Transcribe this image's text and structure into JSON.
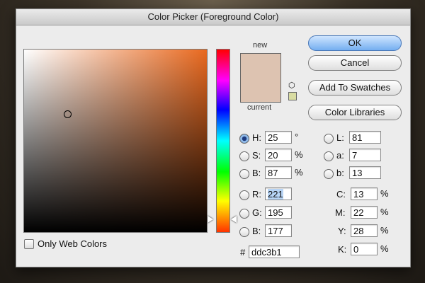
{
  "window": {
    "title": "Color Picker (Foreground Color)"
  },
  "preview": {
    "new_label": "new",
    "current_label": "current",
    "new_color": "#ddc3b1",
    "current_color": "#ddc3b1"
  },
  "buttons": {
    "ok": "OK",
    "cancel": "Cancel",
    "add_to_swatches": "Add To Swatches",
    "color_libraries": "Color Libraries"
  },
  "hsb": {
    "h_label": "H:",
    "h_value": "25",
    "h_unit": "°",
    "s_label": "S:",
    "s_value": "20",
    "s_unit": "%",
    "b_label": "B:",
    "b_value": "87",
    "b_unit": "%"
  },
  "rgb": {
    "r_label": "R:",
    "r_value": "221",
    "g_label": "G:",
    "g_value": "195",
    "b_label": "B:",
    "b_value": "177"
  },
  "lab": {
    "l_label": "L:",
    "l_value": "81",
    "a_label": "a:",
    "a_value": "7",
    "b_label": "b:",
    "b_value": "13"
  },
  "cmyk": {
    "c_label": "C:",
    "c_value": "13",
    "m_label": "M:",
    "m_value": "22",
    "y_label": "Y:",
    "y_value": "28",
    "k_label": "K:",
    "k_value": "0",
    "unit": "%"
  },
  "hex": {
    "label": "#",
    "value": "ddc3b1"
  },
  "web_colors": {
    "label": "Only Web Colors",
    "checked": false
  },
  "icons": {
    "cube": "gamut-cube-icon",
    "web_safe": "web-safe-swatch-icon"
  }
}
